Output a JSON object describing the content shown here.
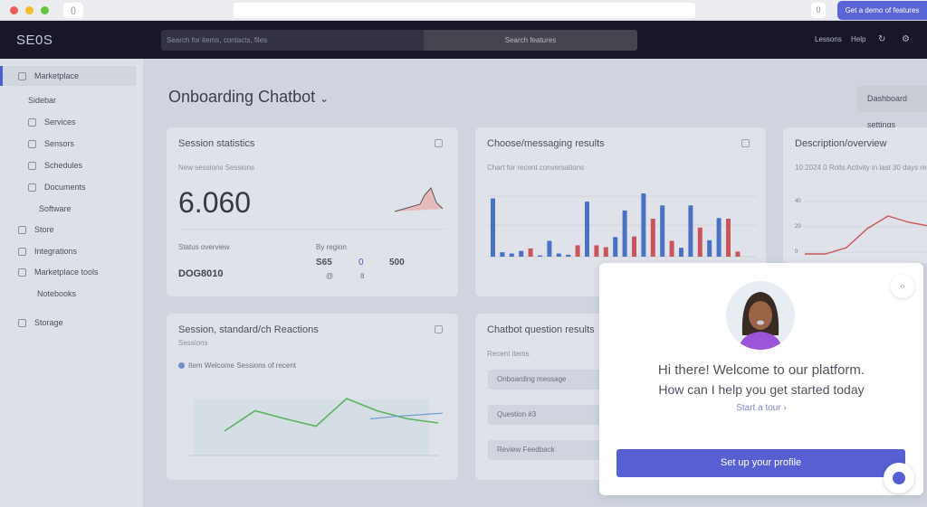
{
  "browser": {
    "tab_icon": "()",
    "ext_icon": "0",
    "top_button": "Get a demo of features",
    "dot_colors": [
      "#ec5f57",
      "#f4bd2f",
      "#5fc73f"
    ]
  },
  "nav": {
    "logo": "SE0S",
    "search_placeholder": "Search for items, contacts, files",
    "search_button": "Search features",
    "right": [
      "Lessons",
      "Help"
    ],
    "icons": [
      "refresh-icon",
      "settings-icon"
    ]
  },
  "sidebar": {
    "items": [
      {
        "label": "Marketplace",
        "icon": true,
        "active": true
      },
      {
        "label": "Sidebar",
        "icon": false
      },
      {
        "label": "Services",
        "icon": true
      },
      {
        "label": "Sensors",
        "icon": true
      },
      {
        "label": "Schedules",
        "icon": true
      },
      {
        "label": "Documents",
        "icon": true
      },
      {
        "label": "Software",
        "icon": false
      },
      {
        "label": "Store",
        "icon": true
      },
      {
        "label": "Integrations",
        "icon": true
      },
      {
        "label": "Marketplace tools",
        "icon": true
      },
      {
        "label": "Notebooks",
        "icon": false
      },
      {
        "label": "Storage",
        "icon": true
      }
    ]
  },
  "page": {
    "title": "Onboarding Chatbot",
    "title_caret": "⌄",
    "header_button": "Dashboard settings"
  },
  "cards": {
    "stats": {
      "title": "Session statistics",
      "subtitle": "New sessions Sessions",
      "value": "6.060",
      "foot_label": "Status overview",
      "foot_value": "DOG8010",
      "mid_label": "By region",
      "nums": [
        "S65",
        "0",
        "500"
      ],
      "sub_nums": [
        "@",
        "8"
      ]
    },
    "bars": {
      "title": "Choose/messaging results",
      "subtitle": "Chart for recent conversations"
    },
    "right": {
      "title": "Description/overview",
      "subtitle": "10 2024 0 Rolls Activity in last 30 days reach",
      "ticks": [
        "40",
        "20",
        "0"
      ]
    },
    "lines": {
      "title": "Session, standard/ch Reactions",
      "subtitle": "Sessions",
      "legend": "Item  Welcome Sessions of recent"
    },
    "list": {
      "title": "Chatbot question results",
      "subtitle": "Recent items",
      "rows": [
        "Onboarding message",
        "Question #3",
        "Review Feedback"
      ]
    }
  },
  "chart_data": [
    {
      "type": "bar",
      "title": "Choose/messaging results",
      "colors": {
        "a": "#4a72c4",
        "b": "#c9555a"
      },
      "series_order": [
        "a",
        "a",
        "a",
        "a",
        "b",
        "a",
        "a",
        "a",
        "a",
        "b",
        "a",
        "b",
        "b",
        "a",
        "a",
        "b",
        "a",
        "b",
        "a",
        "b",
        "a",
        "a",
        "b",
        "a",
        "a",
        "b",
        "b"
      ],
      "values": [
        92,
        7,
        5,
        9,
        13,
        2,
        25,
        5,
        3,
        18,
        87,
        18,
        15,
        31,
        73,
        32,
        100,
        60,
        81,
        25,
        14,
        81,
        46,
        26,
        61,
        60,
        8
      ],
      "ylim": [
        0,
        100
      ]
    },
    {
      "type": "line",
      "title": "Session, standard/ch Reactions",
      "series": [
        {
          "color": "#5bb25f",
          "values": [
            30,
            55,
            45,
            36,
            70,
            55,
            45,
            40
          ]
        },
        {
          "color": "#6f9fd0",
          "values": [
            45,
            48,
            50,
            52
          ]
        }
      ],
      "ylim": [
        0,
        100
      ]
    },
    {
      "type": "line",
      "title": "Description/overview",
      "series": [
        {
          "color": "#c9555a",
          "values": [
            0,
            0,
            5,
            20,
            30,
            25,
            22
          ]
        }
      ],
      "ylim": [
        0,
        40
      ]
    }
  ],
  "chat": {
    "greeting": "Hi there! Welcome to our platform.",
    "body": "How can I help you get started today",
    "link": "Start a tour ›",
    "cta": "Set up your profile",
    "close": "‹›"
  }
}
